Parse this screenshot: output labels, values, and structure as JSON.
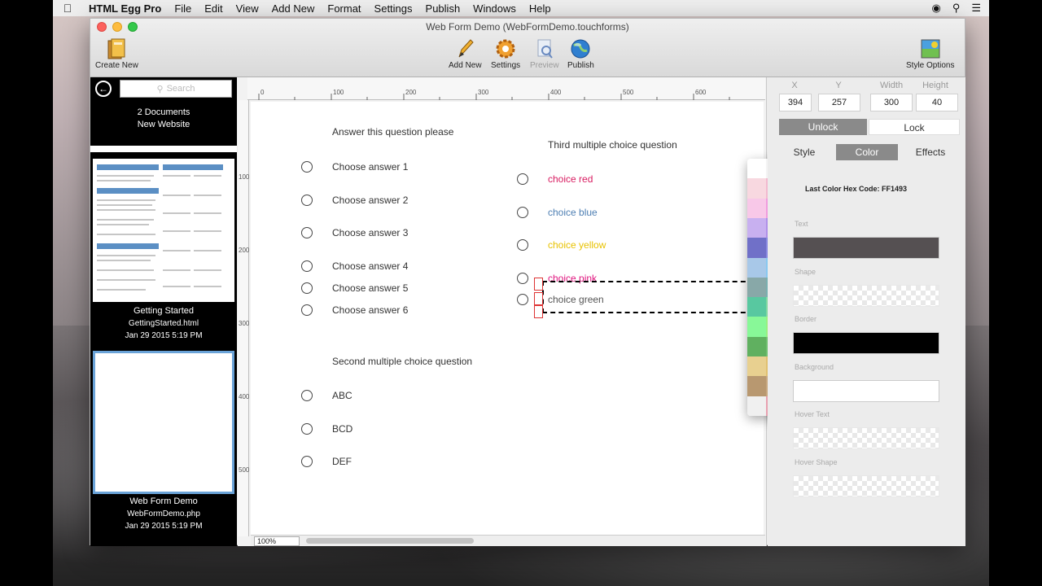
{
  "menubar": {
    "app_name": "HTML Egg Pro",
    "items": [
      "File",
      "Edit",
      "View",
      "Add New",
      "Format",
      "Settings",
      "Publish",
      "Windows",
      "Help"
    ]
  },
  "window": {
    "title": "Web Form Demo (WebFormDemo.touchforms)",
    "toolbar": {
      "create_new": "Create New",
      "add_new": "Add New",
      "settings": "Settings",
      "preview": "Preview",
      "publish": "Publish",
      "style_options": "Style Options"
    }
  },
  "sidebar": {
    "search_placeholder": "Search",
    "count": "2 Documents",
    "site_name": "New Website",
    "documents": [
      {
        "name": "Getting Started",
        "file": "GettingStarted.html",
        "date": "Jan 29 2015 5:19 PM"
      },
      {
        "name": "Web Form Demo",
        "file": "WebFormDemo.php",
        "date": "Jan 29 2015 5:19 PM"
      }
    ]
  },
  "ruler": {
    "h_ticks": [
      "0",
      "100",
      "200",
      "300",
      "400",
      "500",
      "600"
    ],
    "v_ticks": [
      "100",
      "200",
      "300",
      "400",
      "500"
    ]
  },
  "form": {
    "q1": "Answer this question please",
    "q1_answers": [
      "Choose answer 1",
      "Choose answer 2",
      "Choose answer 3",
      "Choose answer 4",
      "Choose answer 5",
      "Choose answer 6"
    ],
    "q2": "Second multiple choice question",
    "q2_answers": [
      "ABC",
      "BCD",
      "DEF"
    ],
    "q3": "Third multiple choice question",
    "q3_answers": [
      "choice red",
      "choice blue",
      "choice yellow",
      "choice pink",
      "choice green"
    ]
  },
  "canvas": {
    "zoom": "100%"
  },
  "inspector": {
    "labels": {
      "x": "X",
      "y": "Y",
      "width": "Width",
      "height": "Height"
    },
    "values": {
      "x": "394",
      "y": "257",
      "width": "300",
      "height": "40"
    },
    "unlock": "Unlock",
    "lock": "Lock",
    "tabs": [
      "Style",
      "Color",
      "Effects"
    ],
    "last_color_label": "Last Color Hex Code:",
    "last_color_value": "FF1493",
    "swatch_labels": [
      "Text",
      "Shape",
      "Border",
      "Background",
      "Hover Text",
      "Hover Shape"
    ],
    "colors": {
      "text": "#555052",
      "border": "#000000",
      "background": "#ffffff"
    }
  },
  "palette": {
    "colors": [
      "#ffffff",
      "#f4f4f4",
      "#ececec",
      "#e2e2e2",
      "#d6d6d6",
      "#cacaca",
      "#a8a8a8",
      "#9a9a9a",
      "#8a8a8a",
      "#5a5a5a",
      "#f8d8e0",
      "#f3b9cf",
      "#e0568f",
      "#f6d6f0",
      "#e28ce0",
      "#d870c8",
      "#f06abf",
      "#e090d8",
      "#c0a0e8",
      "#b2b2ff",
      "#f8c8e8",
      "#f09cde",
      "#e84be0",
      "#c060d0",
      "#b050c8",
      "#cc88ee",
      "#b888f0",
      "#a070e0",
      "#8060e0",
      "#9a98ff",
      "#c8b0f0",
      "#b090e8",
      "#a098f0",
      "#8888d8",
      "#b8a8ff",
      "#9898f8",
      "#7878e0",
      "#6868f0",
      "#5050d8",
      "#8888c0",
      "#7070c8",
      "#8888e0",
      "#a0a8f0",
      "#b8c0f8",
      "#c8d8f8",
      "#d8e8ff",
      "#a0b8e0",
      "#88a8f0",
      "#70a0e8",
      "#c0d0e8",
      "#a8c8e8",
      "#88c8f0",
      "#c0e0f8",
      "#d0e8f0",
      "#a8d0d8",
      "#e8f8ff",
      "#f0fcff",
      "#c8f0f8",
      "#80e8f8",
      "#40d8e8",
      "#88a8a8",
      "#78b0b0",
      "#60c8c0",
      "#a0e0e0",
      "#b0f0e8",
      "#c0f8f0",
      "#98e0d0",
      "#80d8c8",
      "#60d0c0",
      "#d0f8f0",
      "#58c8a0",
      "#80d8a0",
      "#98e8b0",
      "#b0f0c0",
      "#c8f8d0",
      "#e0ffe8",
      "#a8e8c0",
      "#88e0a8",
      "#60d888",
      "#60a860",
      "#88f898",
      "#98f080",
      "#b0f8a0",
      "#c8f8b8",
      "#d8ffc8",
      "#a8c890",
      "#88d878",
      "#68c858",
      "#50b040",
      "#a0c0a0",
      "#60b060",
      "#70c070",
      "#a8e890",
      "#c0f0a0",
      "#d8f8b8",
      "#e8ffc8",
      "#c8e8a0",
      "#b8d888",
      "#a0c070",
      "#d8e8c0",
      "#e8d090",
      "#e0c070",
      "#f0e080",
      "#f8e8a0",
      "#fff0b8",
      "#fff8d0",
      "#f0d888",
      "#e8c868",
      "#d8b858",
      "#f8e0c0",
      "#b89870",
      "#c8a880",
      "#d8b890",
      "#e8c8a0",
      "#f0d0b0",
      "#f8d8c0",
      "#e0a890",
      "#d89078",
      "#c87868",
      "#f0b0a0",
      "#f0f0f0",
      "#e8a0b0",
      "#e890a0",
      "#f07090",
      "#e86080",
      "#d85070",
      "#c84868",
      "#c04060",
      "#b83858",
      "#e04870"
    ]
  }
}
